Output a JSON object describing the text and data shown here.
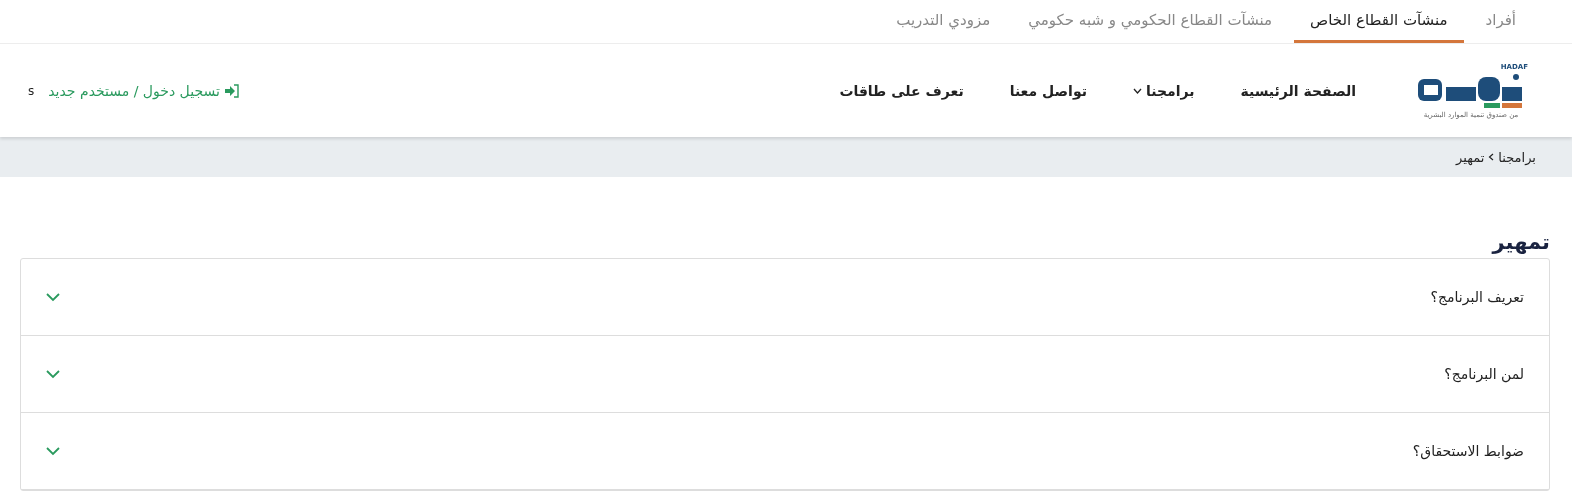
{
  "audience_tabs": [
    {
      "label": "أفراد",
      "selected": false
    },
    {
      "label": "منشآت القطاع الخاص",
      "selected": true
    },
    {
      "label": "منشآت القطاع الحكومي و شبه حكومي",
      "selected": false
    },
    {
      "label": "مزودي التدريب",
      "selected": false
    }
  ],
  "logo": {
    "latin": "HADAF",
    "tagline": "من صندوق تنمية الموارد البشرية"
  },
  "nav": [
    {
      "label": "الصفحة الرئيسية",
      "has_dropdown": false
    },
    {
      "label": "برامجنا",
      "has_dropdown": true
    },
    {
      "label": "تواصل معنا",
      "has_dropdown": false
    },
    {
      "label": "تعرف على طاقات",
      "has_dropdown": false
    }
  ],
  "login": {
    "label": "تسجيل دخول / مستخدم جديد",
    "extra": "s"
  },
  "breadcrumb": [
    "برامجنا",
    "تمهير"
  ],
  "page_title": "تمهير",
  "accordion": [
    {
      "question": "تعريف البرنامج؟",
      "expanded": false
    },
    {
      "question": "لمن البرنامج؟",
      "expanded": false
    },
    {
      "question": "ضوابط الاستحقاق؟",
      "expanded": false
    }
  ]
}
